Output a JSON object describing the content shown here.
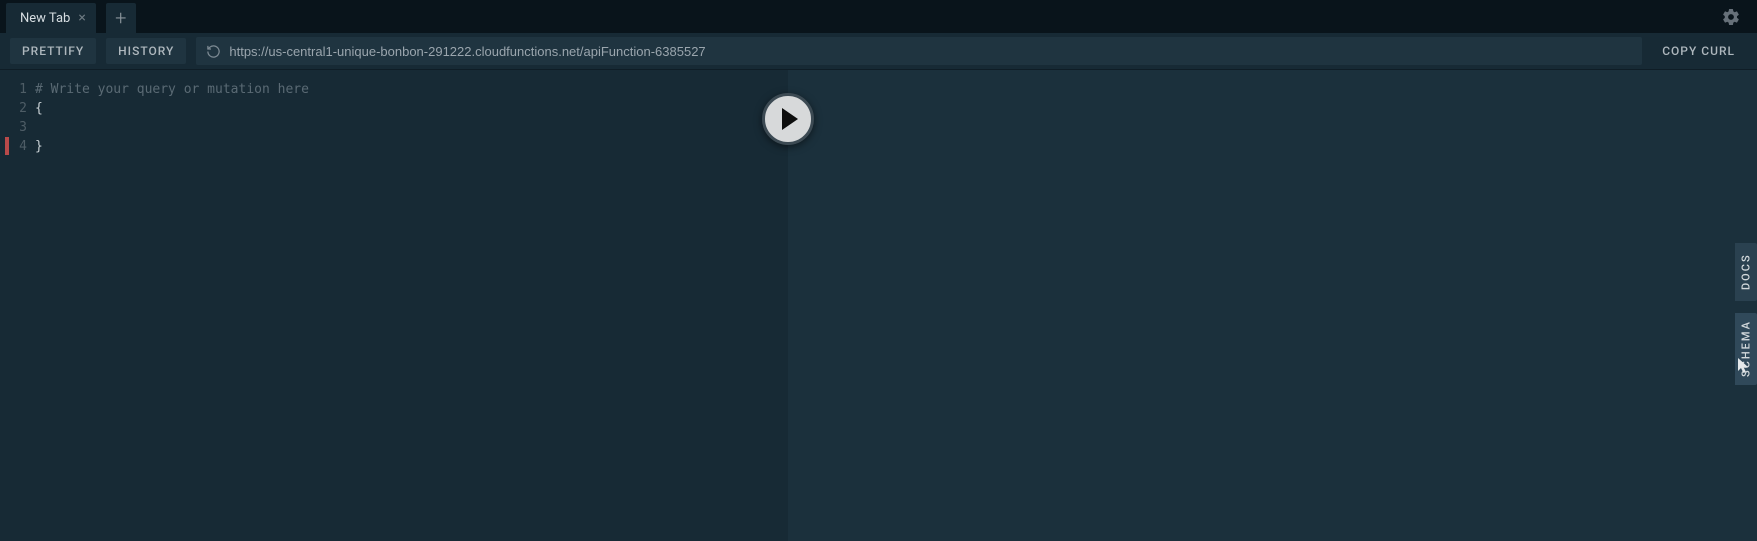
{
  "tabs": {
    "active_label": "New Tab"
  },
  "toolbar": {
    "prettify_label": "PRETTIFY",
    "history_label": "HISTORY",
    "url_value": "https://us-central1-unique-bonbon-291222.cloudfunctions.net/apiFunction-6385527",
    "copy_curl_label": "COPY CURL"
  },
  "editor": {
    "line_numbers": [
      "1",
      "2",
      "3",
      "4"
    ],
    "lines": {
      "l1": "# Write your query or mutation here",
      "l2": "{",
      "l3": "",
      "l4": "}"
    }
  },
  "sidebar": {
    "docs_label": "DOCS",
    "schema_label": "SCHEMA"
  }
}
